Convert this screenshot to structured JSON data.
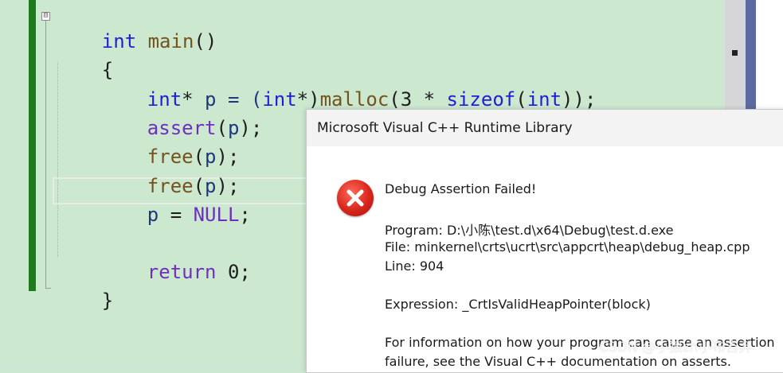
{
  "editor": {
    "lines": [
      [
        "int",
        " ",
        "main",
        "()"
      ],
      [
        "{"
      ],
      [
        "int",
        "*",
        " p = (",
        "int",
        "*)",
        "malloc",
        "(3 * ",
        "sizeof",
        "(",
        "int",
        "));"
      ],
      [
        "assert",
        "(",
        "p",
        ");"
      ],
      [
        "free",
        "(",
        "p",
        ");"
      ],
      [
        "free",
        "(",
        "p",
        ");"
      ],
      [
        "p",
        " = ",
        "NULL",
        ";"
      ],
      [
        "return",
        " 0;"
      ],
      [
        "}"
      ]
    ],
    "fold_symbol": "⊟"
  },
  "dialog": {
    "title": "Microsoft Visual C++ Runtime Library",
    "heading": "Debug Assertion Failed!",
    "program": "Program: D:\\小陈\\test.d\\x64\\Debug\\test.d.exe",
    "file": "File: minkernel\\crts\\ucrt\\src\\appcrt\\heap\\debug_heap.cpp",
    "line": "Line: 904",
    "expression": "Expression: _CrtIsValidHeapPointer(block)",
    "info1": "For information on how your program can cause an assertion",
    "info2": "failure, see the Visual C++ documentation on asserts.",
    "icon": "error-icon"
  },
  "watermark": "CSDN @小狼zh小布吉弃",
  "colors": {
    "editor_bg": "#cce8cf",
    "keyword": "#1f1fd6",
    "function": "#74531f",
    "macro": "#6f2fbf",
    "change_bar": "#1f7a1f",
    "dialog_bg": "#ffffff",
    "error_red": "#d8261c"
  }
}
